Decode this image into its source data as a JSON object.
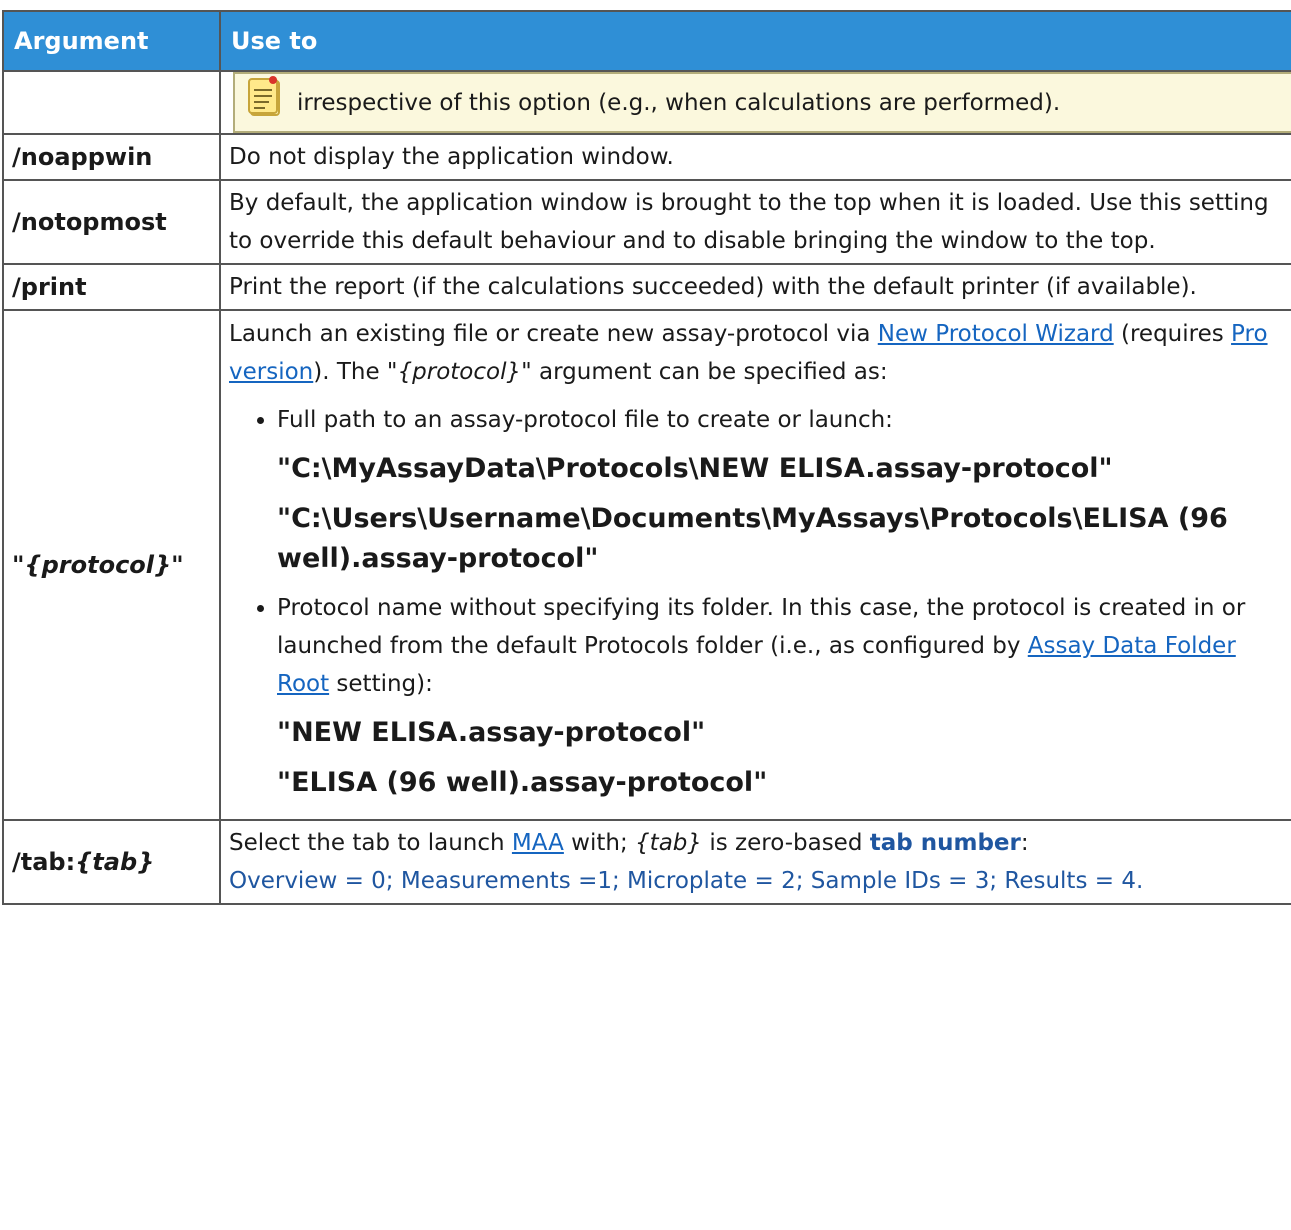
{
  "header": {
    "col_argument": "Argument",
    "col_use": "Use to"
  },
  "note": {
    "icon": "memo-note-icon",
    "text": "irrespective of this option (e.g., when calculations are performed)."
  },
  "rows": {
    "noappwin": {
      "arg": "/noappwin",
      "use": "Do not display the application window."
    },
    "notopmost": {
      "arg": "/notopmost",
      "use": "By default, the application window is brought to the top when it is loaded. Use this setting to override this default behaviour and to disable bringing the window to the top."
    },
    "print": {
      "arg": "/print",
      "use": "Print the report (if the calculations succeeded) with the default printer (if available)."
    },
    "protocol": {
      "arg_quote_open": "\"",
      "arg_name": "{protocol}",
      "arg_quote_close": "\"",
      "intro_1": "Launch an existing file or create new assay-protocol via ",
      "link_wizard": "New Protocol Wizard",
      "intro_2": " (requires ",
      "link_pro": "Pro version",
      "intro_3": "). The \"",
      "intro_arg": "{protocol}",
      "intro_4": "\" argument can be specified as:",
      "bullet_1": "Full path to an assay-protocol file to create or launch:",
      "path_1": "\"C:\\MyAssayData\\Protocols\\NEW ELISA.assay-protocol\"",
      "path_2": "\"C:\\Users\\Username\\Documents\\MyAssays\\Protocols\\ELISA (96 well).assay-protocol\"",
      "bullet_2a": "Protocol name without specifying its folder. In this case, the protocol is created in or launched from the default Protocols folder (i.e., as configured by ",
      "link_root": "Assay Data Folder Root",
      "bullet_2b": " setting):",
      "path_3": "\"NEW ELISA.assay-protocol\"",
      "path_4": "\"ELISA (96 well).assay-protocol\""
    },
    "tab": {
      "arg_prefix": "/tab:",
      "arg_name": "{tab}",
      "use_1": "Select the tab to launch ",
      "link_maa": "MAA",
      "use_2": " with; ",
      "use_tab": "{tab}",
      "use_3": " is zero-based ",
      "use_bold": "tab number",
      "use_4": ":",
      "tabs_list": "Overview = 0; Measurements =1; Microplate = 2; Sample IDs = 3; Results = 4."
    }
  }
}
